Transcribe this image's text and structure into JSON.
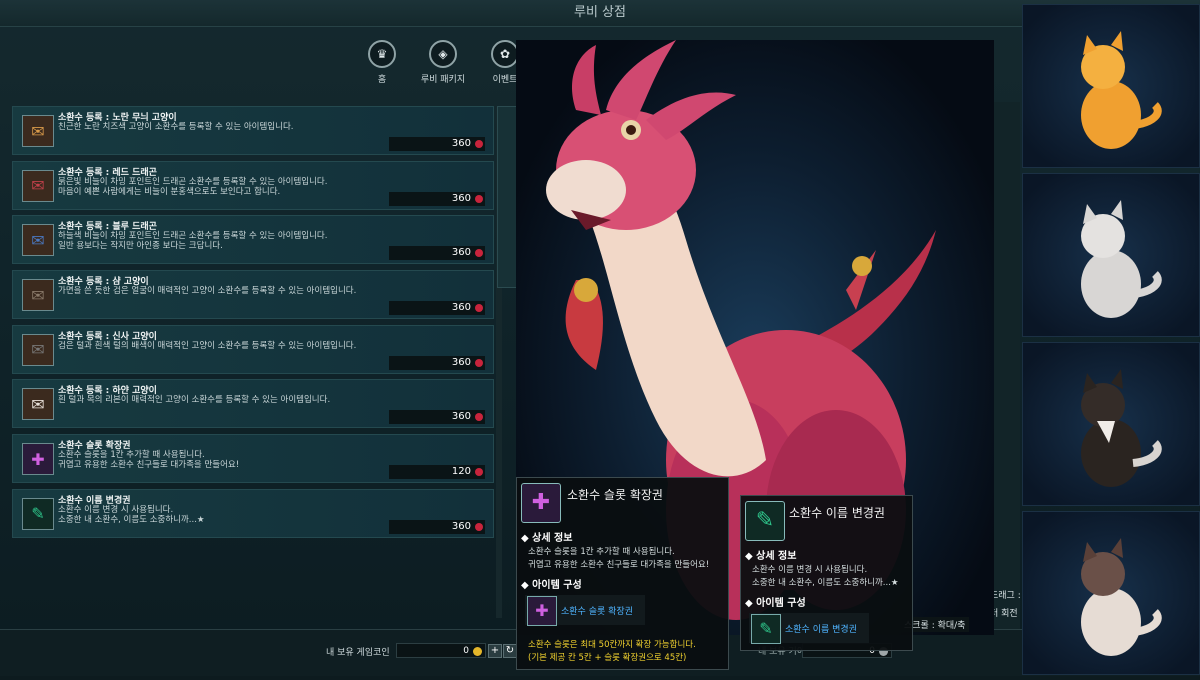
{
  "window": {
    "title": "루비 상점"
  },
  "nav": [
    {
      "label": "홈",
      "icon": "home-icon"
    },
    {
      "label": "루비 패키지",
      "icon": "ruby-package-icon"
    },
    {
      "label": "이벤트",
      "icon": "event-icon"
    }
  ],
  "items": [
    {
      "name": "소환수 등록 : 노란 무늬 고양이",
      "desc": [
        "친근한 노란 치즈색 고양이 소환수를 등록할 수 있는 아이템입니다."
      ],
      "price": "360",
      "icon": "scroll-icon",
      "icon_color": "#d89a4a"
    },
    {
      "name": "소환수 등록 : 레드 드래곤",
      "desc": [
        "붉은빛 비늘이 차밍 포인트인 드래곤 소환수를 등록할 수 있는 아이템입니다.",
        "마음이 예쁜 사람에게는 비늘이 분홍색으로도 보인다고 합니다."
      ],
      "price": "360",
      "icon": "scroll-icon",
      "icon_color": "#c0404a"
    },
    {
      "name": "소환수 등록 : 블루 드래곤",
      "desc": [
        "하늘색 비늘이 차밍 포인트인 드래곤 소환수를 등록할 수 있는 아이템입니다.",
        "일반 용보다는 작지만 아인종 보다는 크답니다."
      ],
      "price": "360",
      "icon": "scroll-icon",
      "icon_color": "#4a78c0"
    },
    {
      "name": "소환수 등록 : 샴 고양이",
      "desc": [
        "가면을 쓴 듯한 검은 얼굴이 매력적인 고양이 소환수를 등록할 수 있는 아이템입니다."
      ],
      "price": "360",
      "icon": "scroll-icon",
      "icon_color": "#5a4a3a"
    },
    {
      "name": "소환수 등록 : 신사 고양이",
      "desc": [
        "검은 털과 흰색 털의 배색이 매력적인 고양이 소환수를 등록할 수 있는 아이템입니다."
      ],
      "price": "360",
      "icon": "scroll-icon",
      "icon_color": "#2a2a2a"
    },
    {
      "name": "소환수 등록 : 하얀 고양이",
      "desc": [
        "흰 털과 목의 리본이 매력적인 고양이 소환수를 등록할 수 있는 아이템입니다."
      ],
      "price": "360",
      "icon": "scroll-icon",
      "icon_color": "#e8e0d8"
    },
    {
      "name": "소환수 슬롯 확장권",
      "desc": [
        "소환수 슬롯을 1칸 추가할 때 사용됩니다.",
        "귀엽고 유용한 소환수 친구들로 대가족을 만들어요!"
      ],
      "price": "120",
      "icon": "slot-ticket-icon",
      "icon_color": "#b04ad0"
    },
    {
      "name": "소환수 이름 변경권",
      "desc": [
        "소환수 이름 변경 시 사용됩니다.",
        "소중한 내 소환수, 이름도 소중하니까...★"
      ],
      "price": "360",
      "icon": "rename-ticket-icon",
      "icon_color": "#2ec48a"
    }
  ],
  "coins": {
    "label": "내 보유 게임코인",
    "value": "0"
  },
  "coins_right": {
    "label": "내 보유 기어",
    "value": "0"
  },
  "controls": {
    "line1": "드래그 : 회",
    "line2": "터 회전",
    "scroll": "스크롤 : 확대/축"
  },
  "tooltip_slot": {
    "title": "소환수 슬롯 확장권",
    "detail_heading": "상세 정보",
    "detail_lines": [
      "소환수 슬롯을 1칸 추가할 때 사용됩니다.",
      "귀엽고 유용한 소환수 친구들로 대가족을 만들어요!"
    ],
    "compose_heading": "아이템 구성",
    "compose_item": "소환수 슬롯 확장권",
    "note_lines": [
      "소환수 슬롯은 최대 50칸까지 확장 가능합니다.",
      "(기본 제공 칸 5칸 + 슬롯 확장권으로 45칸)"
    ]
  },
  "tooltip_rename": {
    "title": "소환수 이름 변경권",
    "detail_heading": "상세 정보",
    "detail_lines": [
      "소환수 이름 변경 시 사용됩니다.",
      "소중한 내 소환수, 이름도 소중하니까...★"
    ],
    "compose_heading": "아이템 구성",
    "compose_item": "소환수 이름 변경권"
  },
  "previews": [
    {
      "name": "yellow-cat",
      "color": "#f0a030"
    },
    {
      "name": "white-cat",
      "color": "#d8d6d4"
    },
    {
      "name": "black-cat",
      "color": "#2a2420"
    },
    {
      "name": "siamese-cat",
      "color": "#e6dcd4"
    }
  ],
  "colors": {
    "ruby": "#c8243c",
    "coin": "#e4b62a",
    "link": "#4fb4ff",
    "note": "#f2d22e"
  }
}
